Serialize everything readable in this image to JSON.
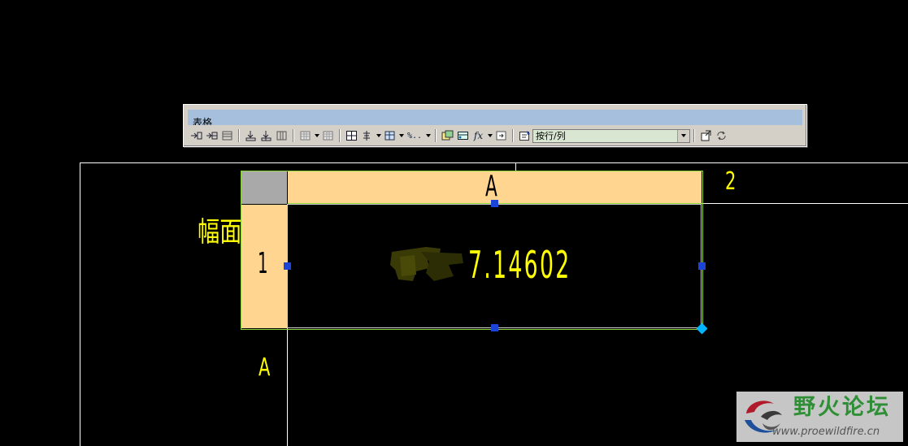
{
  "toolbar": {
    "title": "表格",
    "combo_value": "按行/列",
    "fx_label": "fx",
    "percent_label": "%.."
  },
  "drawing": {
    "label_fumian": "幅面",
    "label_a_bottom": "A",
    "label_2": "2"
  },
  "table": {
    "col_header": "A",
    "row_header": "1",
    "cell_value": "7.14602"
  },
  "watermark": {
    "name": "野火论坛",
    "url": "www.proewildfire.cn"
  },
  "colors": {
    "background": "#000000",
    "drawing_text": "#ffff00",
    "header_fill": "#ffd590",
    "selection_handle": "#1c45d8",
    "corner_handle": "#00b4ff",
    "toolbar_title_bg": "#a6bfdc",
    "combo_bg": "#d8e6d2"
  }
}
